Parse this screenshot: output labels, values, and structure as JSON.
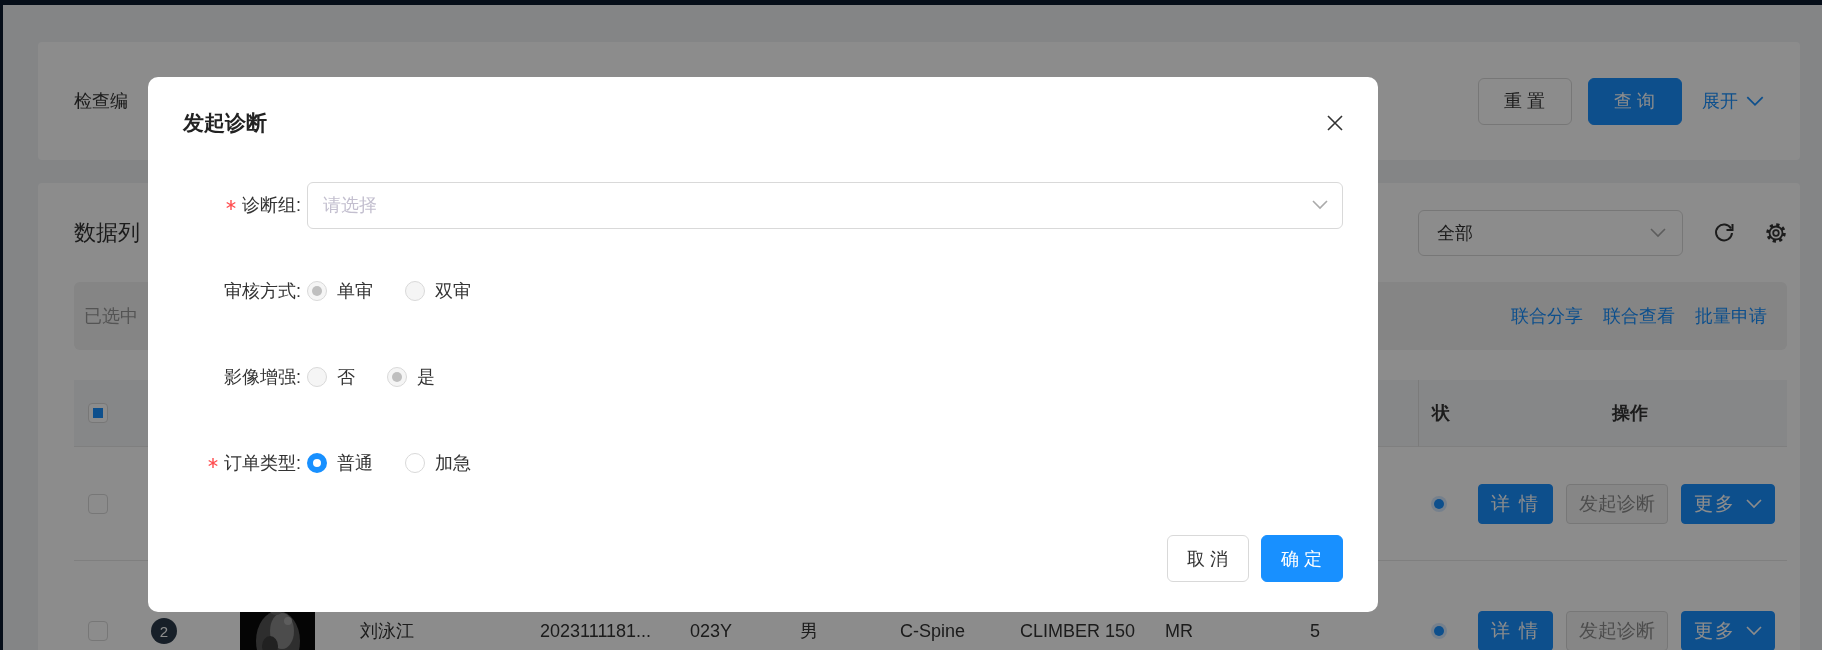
{
  "search_panel": {
    "label": "检查编",
    "buttons": [
      {
        "label": "重 置",
        "kind": "default"
      },
      {
        "label": "查 询",
        "kind": "primary"
      }
    ],
    "expand_link": "展开"
  },
  "data_list": {
    "title": "数据列",
    "filter": {
      "value": "全部"
    },
    "selection_bar": {
      "text": "已选中",
      "actions": [
        "联合分享",
        "联合查看",
        "批量申请"
      ]
    },
    "table": {
      "select_all": {
        "checked": false,
        "indeterminate": true
      },
      "columns": [
        {
          "label": "状"
        },
        {
          "label": "操作"
        }
      ],
      "rows": [
        {
          "checked": false,
          "actions": [
            {
              "label": "详 情",
              "kind": "primary"
            },
            {
              "label": "发起诊断",
              "kind": "disabled"
            },
            {
              "label": "更多",
              "kind": "dropdown"
            }
          ]
        },
        {
          "checked": false,
          "badge": "2",
          "thumbnail": {
            "kind": "picture"
          },
          "cells": [
            "刘泳江",
            "2023111181...",
            "023Y",
            "男",
            "C-Spine",
            "CLIMBER 150",
            "MR",
            "5"
          ],
          "actions": [
            {
              "label": "详 情",
              "kind": "primary"
            },
            {
              "label": "发起诊断",
              "kind": "disabled"
            },
            {
              "label": "更多",
              "kind": "dropdown"
            }
          ]
        }
      ]
    }
  },
  "dialog": {
    "title": "发起诊断",
    "fields": [
      {
        "kind": "select",
        "label": "诊断组:",
        "required": true,
        "placeholder": "请选择"
      },
      {
        "kind": "radio",
        "label": "审核方式:",
        "required": false,
        "disabled": true,
        "options": [
          {
            "label": "单审",
            "selected": true
          },
          {
            "label": "双审",
            "selected": false
          }
        ]
      },
      {
        "kind": "radio",
        "label": "影像增强:",
        "required": false,
        "disabled": true,
        "options": [
          {
            "label": "否",
            "selected": false
          },
          {
            "label": "是",
            "selected": true
          }
        ]
      },
      {
        "kind": "radio",
        "label": "订单类型:",
        "required": true,
        "disabled": false,
        "options": [
          {
            "label": "普通",
            "selected": true
          },
          {
            "label": "加急",
            "selected": false
          }
        ]
      }
    ],
    "buttons": [
      {
        "label": "取 消",
        "kind": "default"
      },
      {
        "label": "确 定",
        "kind": "primary"
      }
    ]
  }
}
